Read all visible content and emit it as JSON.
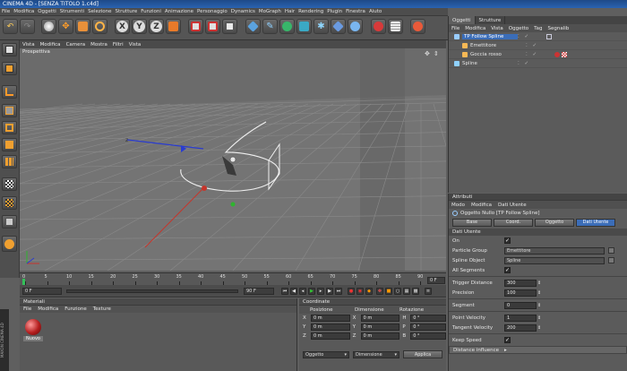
{
  "title_bar": {
    "text": "CINEMA 4D - [SENZA TITOLO 1.c4d]"
  },
  "menu": [
    "File",
    "Modifica",
    "Oggetti",
    "Strumenti",
    "Selezione",
    "Strutture",
    "Funzioni",
    "Animazione",
    "Personaggio",
    "Dynamics",
    "MoGraph",
    "Hair",
    "Rendering",
    "Plugin",
    "Finestra",
    "Aiuto"
  ],
  "viewport": {
    "menu": [
      "Vista",
      "Modifica",
      "Camera",
      "Mostra",
      "Filtri",
      "Vista"
    ],
    "label": "Prospettiva"
  },
  "timeline": {
    "ticks": [
      "0",
      "5",
      "10",
      "15",
      "20",
      "25",
      "30",
      "35",
      "40",
      "45",
      "50",
      "55",
      "60",
      "65",
      "70",
      "75",
      "80",
      "85",
      "90"
    ],
    "current_frame": "0 F",
    "start_field": "0 F",
    "end_field": "90 F",
    "frame_readout": "0 F"
  },
  "materials": {
    "header": "Materiali",
    "menu": [
      "File",
      "Modifica",
      "Funzione",
      "Texture"
    ],
    "items": [
      {
        "name": "Nuovo"
      }
    ]
  },
  "coordinates": {
    "header": "Coordinate",
    "columns": [
      "Posizione",
      "Dimensione",
      "Rotazione"
    ],
    "rows": [
      {
        "axis": "X",
        "pos": "0 m",
        "dim": "0 m",
        "rot_axis": "H",
        "rot": "0 °"
      },
      {
        "axis": "Y",
        "pos": "0 m",
        "dim": "0 m",
        "rot_axis": "P",
        "rot": "0 °"
      },
      {
        "axis": "Z",
        "pos": "0 m",
        "dim": "0 m",
        "rot_axis": "B",
        "rot": "0 °"
      }
    ],
    "mode_select": "Oggetto",
    "size_select": "Dimensione",
    "apply_button": "Applica"
  },
  "objects": {
    "tabs": [
      "Oggetti",
      "Strutture"
    ],
    "menu": [
      "File",
      "Modifica",
      "Vista",
      "Oggetto",
      "Tag",
      "Segnalib"
    ],
    "tree": [
      {
        "name": "TP Follow Spline",
        "indent": 0,
        "selected": true
      },
      {
        "name": "Emettitore",
        "indent": 1,
        "selected": false
      },
      {
        "name": "Goccia rosso",
        "indent": 1,
        "selected": false
      },
      {
        "name": "Spline",
        "indent": 0,
        "selected": false
      }
    ]
  },
  "attributes": {
    "header": "Attributi",
    "menu": [
      "Modo",
      "Modifica",
      "Dati Utente"
    ],
    "object_title": "Oggetto Nullo [TP Follow Spline]",
    "tabs": [
      "Base",
      "Coord.",
      "Oggetto",
      "Dati Utente"
    ],
    "active_tab": "Dati Utente",
    "section": "Dati Utente",
    "properties": [
      {
        "label": "On",
        "kind": "check",
        "value": "✓"
      },
      {
        "label": "Particle Group",
        "kind": "link",
        "value": "Emettitore"
      },
      {
        "label": "Spline Object",
        "kind": "link",
        "value": "Spline"
      },
      {
        "label": "All Segments",
        "kind": "check",
        "value": "✓"
      },
      {
        "label": "Trigger Distance",
        "kind": "num",
        "value": "300"
      },
      {
        "label": "Precision",
        "kind": "num",
        "value": "100"
      },
      {
        "label": "Segment",
        "kind": "num",
        "value": "0"
      },
      {
        "label": "Point Velocity",
        "kind": "num",
        "value": "1"
      },
      {
        "label": "Tangent Velocity",
        "kind": "num",
        "value": "200"
      },
      {
        "label": "Keep Speed",
        "kind": "check",
        "value": "✓"
      }
    ],
    "collapsed_group": "Distance influence"
  },
  "side_strip": "MAXON CINEMA 4D",
  "colors": {
    "accent": "#2a63b0",
    "selected_tab": "#3b6db8",
    "axis_x": "#d43b2e",
    "axis_y": "#3cbf3c",
    "axis_z": "#3a5ad6"
  }
}
